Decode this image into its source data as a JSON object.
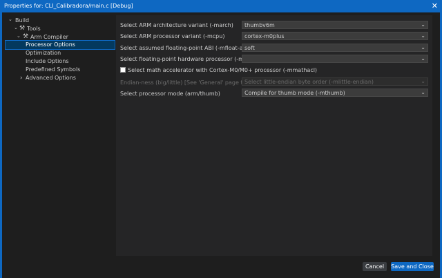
{
  "window": {
    "title": "Properties for: CLI_Calibradora/main.c [Debug]",
    "close_glyph": "✕"
  },
  "tree": {
    "items": [
      {
        "label": "Build",
        "arrow": "⌄",
        "icon": "",
        "selected": false
      },
      {
        "label": "Tools",
        "arrow": "⌄",
        "icon": "wrench-icon",
        "selected": false
      },
      {
        "label": "Arm Compiler",
        "arrow": "⌄",
        "icon": "wrench-icon",
        "selected": false
      },
      {
        "label": "Processor Options",
        "arrow": "",
        "icon": "",
        "selected": true
      },
      {
        "label": "Optimization",
        "arrow": "",
        "icon": "",
        "selected": false
      },
      {
        "label": "Include Options",
        "arrow": "",
        "icon": "",
        "selected": false
      },
      {
        "label": "Predefined Symbols",
        "arrow": "",
        "icon": "",
        "selected": false
      },
      {
        "label": "Advanced Options",
        "arrow": "›",
        "icon": "",
        "selected": false
      }
    ]
  },
  "options": {
    "march": {
      "label": "Select ARM architecture variant (-march)",
      "value": "thumbv6m"
    },
    "mcpu": {
      "label": "Select ARM processor variant (-mcpu)",
      "value": "cortex-m0plus"
    },
    "mfloat_abi": {
      "label": "Select assumed floating-point ABI (-mfloat-abi)",
      "value": "soft"
    },
    "mfpu": {
      "label": "Select floating-point hardware processor (-mfpu)",
      "value": ""
    },
    "mmathacl": {
      "label": "Select math accelerator with Cortex-M0/M0+ processor (-mmathacl)",
      "checked": false
    },
    "endian": {
      "label": "Endian-ness (big/little) [See 'General' page to edit]",
      "value": "Select little-endian byte order (-mlittle-endian)"
    },
    "mode": {
      "label": "Select processor mode (arm/thumb)",
      "value": "Compile for thumb mode (-mthumb)"
    }
  },
  "buttons": {
    "cancel": "Cancel",
    "save": "Save and Close"
  },
  "glyphs": {
    "chevron": "⌄",
    "wrench": "⚒"
  },
  "colors": {
    "accent": "#0e68c2",
    "selection": "#04395e",
    "background": "#1e1e1e",
    "panel": "#252526"
  }
}
